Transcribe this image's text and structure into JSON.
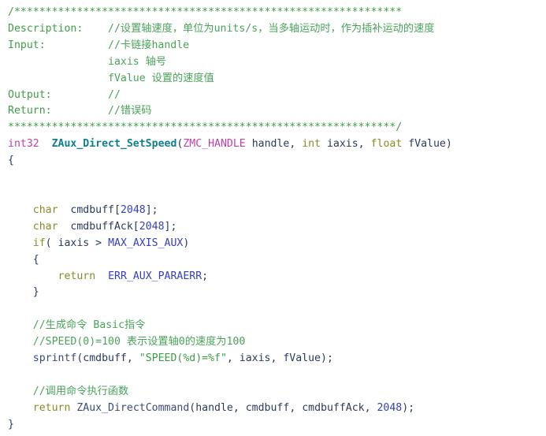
{
  "editor": {
    "language": "C",
    "background": "#ffffff",
    "font_size_px": 13,
    "colors": {
      "comment": "#3f9c48",
      "keyword": "#8a8a28",
      "type": "#c23fa8",
      "function_definition": "#0f7f8f",
      "identifier": "#2b3a5e",
      "constant": "#3340c4",
      "string": "#3f9c48"
    }
  },
  "code": {
    "lines": [
      {
        "id": "line-1-banner-open",
        "tokens": [
          {
            "t": "/**************************************************************",
            "c": "cm"
          }
        ]
      },
      {
        "id": "line-2-description",
        "tokens": [
          {
            "t": "Description:    ",
            "c": "cm"
          },
          {
            "t": "//设置轴速度，单位为units/s，当多轴运动时，作为插补运动的速度",
            "c": "cmz"
          }
        ]
      },
      {
        "id": "line-3-input",
        "tokens": [
          {
            "t": "Input:          ",
            "c": "cm"
          },
          {
            "t": "//卡链接handle",
            "c": "cmz"
          }
        ]
      },
      {
        "id": "line-4-input-iaxis",
        "tokens": [
          {
            "t": "                iaxis 轴号",
            "c": "cmz"
          }
        ]
      },
      {
        "id": "line-5-input-fvalue",
        "tokens": [
          {
            "t": "                fValue 设置的速度值",
            "c": "cmz"
          }
        ]
      },
      {
        "id": "line-6-output",
        "tokens": [
          {
            "t": "Output:         ",
            "c": "cm"
          },
          {
            "t": "//",
            "c": "cmz"
          }
        ]
      },
      {
        "id": "line-7-return",
        "tokens": [
          {
            "t": "Return:         ",
            "c": "cm"
          },
          {
            "t": "//错误码",
            "c": "cmz"
          }
        ]
      },
      {
        "id": "line-8-banner-close",
        "tokens": [
          {
            "t": "**************************************************************/",
            "c": "cm"
          }
        ]
      },
      {
        "id": "line-9-signature",
        "tokens": [
          {
            "t": "int32",
            "c": "ty"
          },
          {
            "t": "  ",
            "c": "pn"
          },
          {
            "t": "ZAux_Direct_SetSpeed",
            "c": "fn"
          },
          {
            "t": "(",
            "c": "pn"
          },
          {
            "t": "ZMC_HANDLE",
            "c": "ty"
          },
          {
            "t": " handle, ",
            "c": "id"
          },
          {
            "t": "int",
            "c": "kw"
          },
          {
            "t": " iaxis, ",
            "c": "id"
          },
          {
            "t": "float",
            "c": "kw"
          },
          {
            "t": " fValue)",
            "c": "id"
          }
        ]
      },
      {
        "id": "line-10-open-brace",
        "tokens": [
          {
            "t": "{",
            "c": "pn"
          }
        ]
      },
      {
        "id": "line-11-blank",
        "tokens": [
          {
            "t": " ",
            "c": "pn"
          }
        ]
      },
      {
        "id": "line-12-blank",
        "tokens": [
          {
            "t": " ",
            "c": "pn"
          }
        ]
      },
      {
        "id": "line-13-decl-cmdbuff",
        "tokens": [
          {
            "t": "    ",
            "c": "pn"
          },
          {
            "t": "char",
            "c": "kw"
          },
          {
            "t": "  cmdbuff[",
            "c": "id"
          },
          {
            "t": "2048",
            "c": "cn"
          },
          {
            "t": "];",
            "c": "id"
          }
        ]
      },
      {
        "id": "line-14-decl-cmdbuffack",
        "tokens": [
          {
            "t": "    ",
            "c": "pn"
          },
          {
            "t": "char",
            "c": "kw"
          },
          {
            "t": "  cmdbuffAck[",
            "c": "id"
          },
          {
            "t": "2048",
            "c": "cn"
          },
          {
            "t": "];",
            "c": "id"
          }
        ]
      },
      {
        "id": "line-15-if",
        "tokens": [
          {
            "t": "    ",
            "c": "pn"
          },
          {
            "t": "if",
            "c": "kw"
          },
          {
            "t": "( iaxis > ",
            "c": "id"
          },
          {
            "t": "MAX_AXIS_AUX",
            "c": "cn"
          },
          {
            "t": ")",
            "c": "id"
          }
        ]
      },
      {
        "id": "line-16-if-open-brace",
        "tokens": [
          {
            "t": "    {",
            "c": "pn"
          }
        ]
      },
      {
        "id": "line-17-return-err",
        "tokens": [
          {
            "t": "        ",
            "c": "pn"
          },
          {
            "t": "return",
            "c": "kw"
          },
          {
            "t": "  ",
            "c": "id"
          },
          {
            "t": "ERR_AUX_PARAERR",
            "c": "cn"
          },
          {
            "t": ";",
            "c": "id"
          }
        ]
      },
      {
        "id": "line-18-if-close-brace",
        "tokens": [
          {
            "t": "    }",
            "c": "pn"
          }
        ]
      },
      {
        "id": "line-19-blank",
        "tokens": [
          {
            "t": " ",
            "c": "pn"
          }
        ]
      },
      {
        "id": "line-20-comment-gen",
        "tokens": [
          {
            "t": "    ",
            "c": "pn"
          },
          {
            "t": "//生成命令 Basic指令",
            "c": "cmz"
          }
        ]
      },
      {
        "id": "line-21-comment-speed",
        "tokens": [
          {
            "t": "    ",
            "c": "pn"
          },
          {
            "t": "//SPEED(0)=100 表示设置轴0的速度为100",
            "c": "cmz"
          }
        ]
      },
      {
        "id": "line-22-sprintf",
        "tokens": [
          {
            "t": "    ",
            "c": "pn"
          },
          {
            "t": "sprintf",
            "c": "call"
          },
          {
            "t": "(cmdbuff, ",
            "c": "id"
          },
          {
            "t": "\"SPEED(%d)=%f\"",
            "c": "st"
          },
          {
            "t": ", iaxis, fValue);",
            "c": "id"
          }
        ]
      },
      {
        "id": "line-23-blank",
        "tokens": [
          {
            "t": " ",
            "c": "pn"
          }
        ]
      },
      {
        "id": "line-24-comment-call",
        "tokens": [
          {
            "t": "    ",
            "c": "pn"
          },
          {
            "t": "//调用命令执行函数",
            "c": "cmz"
          }
        ]
      },
      {
        "id": "line-25-return-call",
        "tokens": [
          {
            "t": "    ",
            "c": "pn"
          },
          {
            "t": "return",
            "c": "kw"
          },
          {
            "t": " ",
            "c": "id"
          },
          {
            "t": "ZAux_DirectCommand",
            "c": "call"
          },
          {
            "t": "(handle, cmdbuff, cmdbuffAck, ",
            "c": "id"
          },
          {
            "t": "2048",
            "c": "cn"
          },
          {
            "t": ");",
            "c": "id"
          }
        ]
      },
      {
        "id": "line-26-close-brace",
        "tokens": [
          {
            "t": "}",
            "c": "pn"
          }
        ]
      }
    ]
  }
}
